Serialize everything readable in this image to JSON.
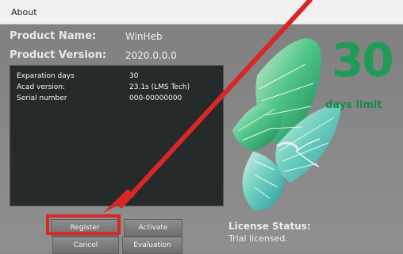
{
  "window": {
    "title": "About"
  },
  "product": {
    "name_label": "Product Name:",
    "name_value": "WinHeb",
    "version_label": "Product Version:",
    "version_value": "2020.0.0.0"
  },
  "details": [
    {
      "key": "Exparation days",
      "value": "30"
    },
    {
      "key": "Acad version:",
      "value": "23.1s (LMS Tech)"
    },
    {
      "key": "Serial number",
      "value": "000-00000000"
    }
  ],
  "license": {
    "days": "30",
    "days_label": "days limit",
    "status_label": "License Status:",
    "status_value": "Trial licensed."
  },
  "buttons": {
    "register": "Register",
    "activate": "Activate",
    "cancel": "Cancel",
    "evaluation": "Evaluation"
  },
  "colors": {
    "accent_green": "#1f9b55",
    "highlight_red": "#d72727"
  }
}
